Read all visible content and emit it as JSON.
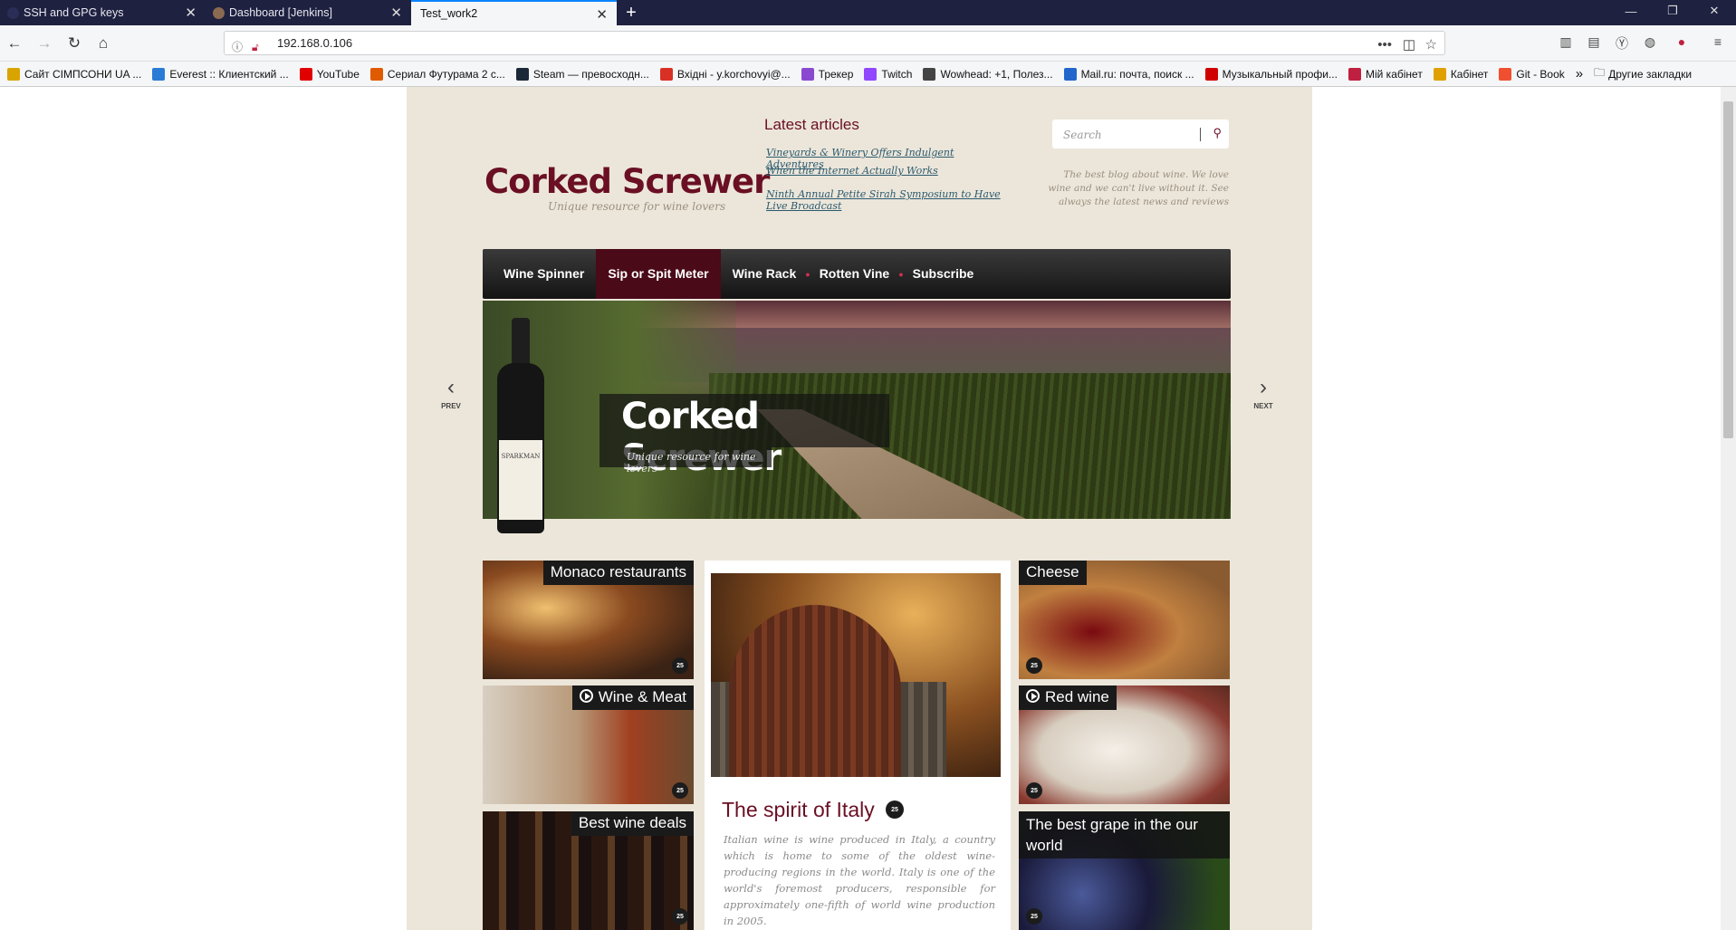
{
  "browser": {
    "tabs": [
      {
        "title": "SSH and GPG keys"
      },
      {
        "title": "Dashboard [Jenkins]"
      },
      {
        "title": "Test_work2"
      }
    ],
    "url": "192.168.0.106",
    "bookmarks": [
      {
        "label": "Сайт СІМПСОНИ UA ...",
        "color": "#d9a400"
      },
      {
        "label": "Everest :: Клиентский ...",
        "color": "#2a7bd5"
      },
      {
        "label": "YouTube",
        "color": "#e00000"
      },
      {
        "label": "Сериал Футурама 2 с...",
        "color": "#e05a00"
      },
      {
        "label": "Steam — превосходн...",
        "color": "#1b2838"
      },
      {
        "label": "Вхідні - y.korchovyi@...",
        "color": "#d93025"
      },
      {
        "label": "Трекер",
        "color": "#8a4ad0"
      },
      {
        "label": "Twitch",
        "color": "#9146ff"
      },
      {
        "label": "Wowhead: +1, Полез...",
        "color": "#444444"
      },
      {
        "label": "Mail.ru: почта, поиск ...",
        "color": "#2266cc"
      },
      {
        "label": "Музыкальный профи...",
        "color": "#d00000"
      },
      {
        "label": "Мій кабінет",
        "color": "#c02040"
      },
      {
        "label": "Кабінет",
        "color": "#e0a000"
      },
      {
        "label": "Git - Book",
        "color": "#f05030"
      }
    ],
    "more_bookmarks": "Другие закладки"
  },
  "site": {
    "logo_title": "Corked Screwer",
    "logo_tagline": "Unique resource for wine lovers",
    "latest_heading": "Latest articles",
    "articles": [
      "Vineyards & Winery Offers Indulgent Adventures",
      "When the Internet Actually Works",
      "Ninth Annual Petite Sirah Symposium to Have Live Broadcast"
    ],
    "search_placeholder": "Search",
    "about": "The best blog about wine. We love wine and we can't live without it. See always the latest news and reviews",
    "menu": [
      "Wine Spinner",
      "Sip or Spit Meter",
      "Wine Rack",
      "Rotten Vine",
      "Subscribe"
    ],
    "hero": {
      "title": "Corked Screwer",
      "tagline": "Unique resource for wine lovers",
      "bottle_label": "SPARKMAN",
      "prev": "PREV",
      "next": "NEXT"
    },
    "tiles": [
      {
        "title": "Monaco restaurants",
        "count": "25"
      },
      {
        "title": "Wine & Meat",
        "count": "25"
      },
      {
        "title": "Best wine deals",
        "count": "25"
      },
      {
        "title": "Cheese",
        "count": "25"
      },
      {
        "title": "Red wine",
        "count": "25"
      },
      {
        "title": "The best grape in the our world",
        "count": "25"
      }
    ],
    "feature": {
      "title": "The spirit of Italy",
      "count": "25",
      "text": "Italian wine is wine produced in Italy, a country which is home to some of the oldest wine-producing regions in the world. Italy is one of the world's foremost producers, responsible for approximately one-fifth of world wine production in 2005."
    }
  }
}
